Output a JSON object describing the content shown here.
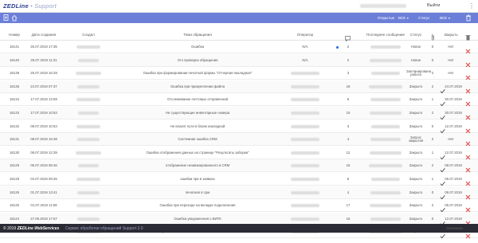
{
  "app": {
    "logo_main": "ZEDLine",
    "logo_sep": " • ",
    "logo_sub": "Support",
    "exit_label": "Выйти"
  },
  "filters": {
    "items": [
      {
        "label": "Открытые",
        "dropdown": false
      },
      {
        "label": "ВСЕ",
        "dropdown": true
      },
      {
        "label": "Статус",
        "dropdown": false
      },
      {
        "label": "ВСЕ",
        "dropdown": true
      }
    ]
  },
  "table": {
    "headers": [
      "Номер",
      "Дата создания",
      "Создал",
      "Тема обращения",
      "Оператор",
      "Сообщения",
      "Последнее сообщение",
      "Статус",
      "Вложения",
      "Закрыть",
      "Удалить"
    ],
    "rows": [
      {
        "num": "18141",
        "date": "26.07.2019 17:35",
        "topic": "Ошибка",
        "operator": "N/A",
        "new": true,
        "msgs": "2",
        "status": "Новое",
        "att": "0",
        "closed": "Нет",
        "closed_date": ""
      },
      {
        "num": "18140",
        "date": "26.07.2019 11:31",
        "topic": "Это проверка обращения",
        "operator": "N/A",
        "new": false,
        "msgs": "2",
        "status": "Новое",
        "att": "0",
        "closed": "Нет",
        "closed_date": ""
      },
      {
        "num": "18138",
        "date": "25.07.2019 16:29",
        "topic": "Ошибка при формировании печатной формы \"Отчерная накладная\"",
        "operator": "",
        "new": false,
        "msgs": "3",
        "status": "Запланирована работа",
        "att": "2",
        "closed": "Нет",
        "closed_date": ""
      },
      {
        "num": "18135",
        "date": "24.07.2019 07:37",
        "topic": "Ошибка при прикреплении файла",
        "operator": "",
        "new": false,
        "msgs": "18",
        "status": "Закрыто",
        "att": "2",
        "closed": "",
        "closed_date": "24.07.2019"
      },
      {
        "num": "18134",
        "date": "17.07.2019 13:59",
        "topic": "Отслеживание почтовых отправлений",
        "operator": "",
        "new": false,
        "msgs": "9",
        "status": "Закрыто",
        "att": "1",
        "closed": "",
        "closed_date": "30.07.2019"
      },
      {
        "num": "18133",
        "date": "17.07.2019 10:53",
        "topic": "Не существующие инвентарные номера",
        "operator": "",
        "new": false,
        "msgs": "10",
        "status": "Закрыто",
        "att": "2",
        "closed": "",
        "closed_date": "30.07.2019"
      },
      {
        "num": "18132",
        "date": "09.07.2019 10:53",
        "topic": "Не влазят пути в бланк накладной",
        "operator": "",
        "new": false,
        "msgs": "3",
        "status": "Закрыто",
        "att": "0",
        "closed": "",
        "closed_date": "12.07.2019"
      },
      {
        "num": "18131",
        "date": "08.07.2019 16:48",
        "topic": "Системная ошибка CRM",
        "operator": "",
        "new": false,
        "msgs": "4",
        "status": "Запрос закрытия",
        "att": "2",
        "closed": "Нет",
        "closed_date": ""
      },
      {
        "num": "18130",
        "date": "08.07.2019 12:39",
        "topic": "Ошибка отображения данных на странице \"Результаты заборки\"",
        "operator": "",
        "new": false,
        "msgs": "12",
        "status": "Закрыто",
        "att": "1",
        "closed": "",
        "closed_date": "12.07.2019"
      },
      {
        "num": "18129",
        "date": "05.07.2019 08:46",
        "topic": "отображение незавизированного в CRM",
        "operator": "",
        "new": false,
        "msgs": "15",
        "status": "Закрыто",
        "att": "2",
        "closed": "",
        "closed_date": "08.07.2019"
      },
      {
        "num": "18128",
        "date": "04.07.2019 09:26",
        "topic": "ошибки при в заявках",
        "operator": "",
        "new": false,
        "msgs": "8",
        "status": "Закрыто",
        "att": "1",
        "closed": "",
        "closed_date": "05.07.2019"
      },
      {
        "num": "18126",
        "date": "01.07.2019 13:41",
        "topic": "печатная в срм",
        "operator": "",
        "new": false,
        "msgs": "4",
        "status": "Закрыто",
        "att": "0",
        "closed": "",
        "closed_date": "09.07.2019"
      },
      {
        "num": "18125",
        "date": "01.07.2019 11:59",
        "topic": "Ошибка при переходе на вкладке подключения",
        "operator": "",
        "new": false,
        "msgs": "17",
        "status": "Закрыто",
        "att": "2",
        "closed": "",
        "closed_date": "05.07.2019"
      },
      {
        "num": "18124",
        "date": "27.06.2019 17:57",
        "topic": "Ошибка уведомления о ВИТК",
        "operator": "",
        "new": false,
        "msgs": "16",
        "status": "Закрыто",
        "att": "0",
        "closed": "",
        "closed_date": "12.07.2019"
      },
      {
        "num": "18123",
        "date": "25.06.2019 12:22",
        "topic": "не отправляются тексты смс ЛАГОТ с Ph с заявкой CRM",
        "operator": "",
        "new": false,
        "msgs": "5",
        "status": "Закрыто",
        "att": "1",
        "closed": "",
        "closed_date": "27.06.2019"
      }
    ]
  },
  "footer": {
    "copyright": "© 2019 ",
    "brand": "ZEDLine WebServices",
    "service": "Сервис обработки обращений Support 2.0",
    "right": "Оплачено"
  },
  "colors": {
    "accent": "#6c7fd8",
    "footer_bg": "#2b2b35",
    "close_x": "#e53935",
    "check": "#333333",
    "new_dot": "#2f6fe0"
  }
}
